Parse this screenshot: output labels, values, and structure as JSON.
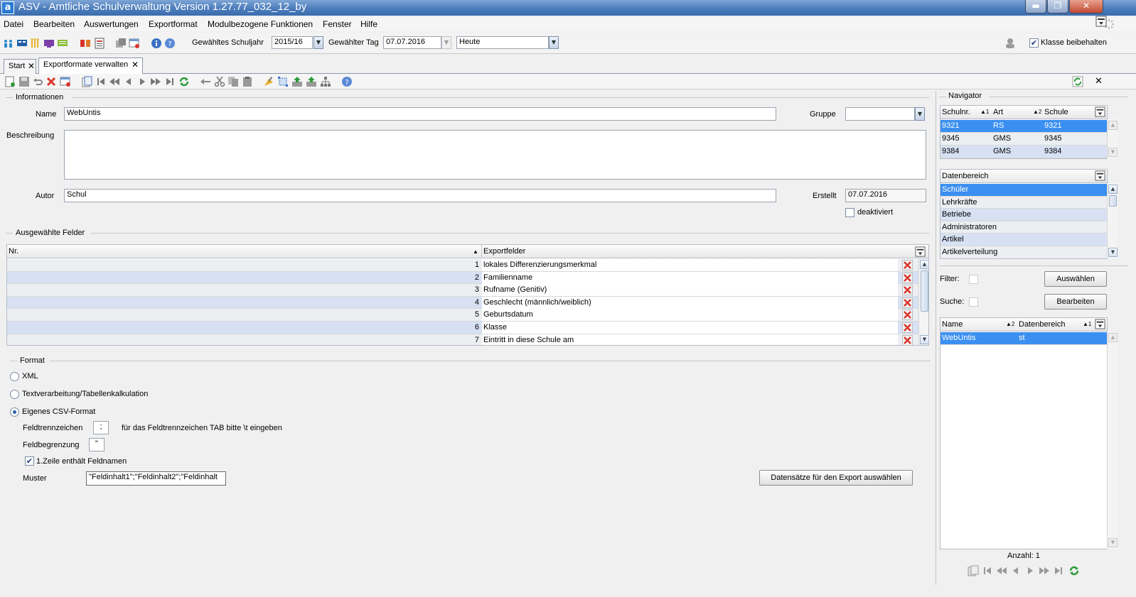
{
  "window": {
    "title": "ASV - Amtliche Schulverwaltung Version 1.27.77_032_12_by",
    "logo_letter": "a",
    "minimize": "▬",
    "restore": "❐",
    "close": "✕"
  },
  "menu": [
    "Datei",
    "Bearbeiten",
    "Auswertungen",
    "Exportformat",
    "Modulbezogene Funktionen",
    "Fenster",
    "Hilfe"
  ],
  "toolbar": {
    "schuljahr_label": "Gewähltes Schuljahr",
    "schuljahr_value": "2015/16",
    "tag_label": "Gewählter Tag",
    "tag_value": "07.07.2016",
    "heute_value": "Heute",
    "klasse_label": "Klasse beibehalten",
    "klasse_checked": true
  },
  "tabs": [
    {
      "label": "Start",
      "close": "✕"
    },
    {
      "label": "Exportformate verwalten",
      "close": "✕"
    }
  ],
  "panel_close": "✕",
  "informationen": {
    "section": "Informationen",
    "name_label": "Name",
    "name_value": "WebUntis",
    "gruppe_label": "Gruppe",
    "gruppe_value": "",
    "beschreibung_label": "Beschreibung",
    "beschreibung_value": "",
    "autor_label": "Autor",
    "autor_value": "Schul",
    "erstellt_label": "Erstellt",
    "erstellt_value": "07.07.2016",
    "deaktiviert_label": "deaktiviert"
  },
  "felder": {
    "section": "Ausgewählte Felder",
    "col_nr": "Nr.",
    "col_export": "Exportfelder",
    "rows": [
      {
        "nr": "1",
        "feld": "lokales Differenzierungsmerkmal"
      },
      {
        "nr": "2",
        "feld": "Familienname"
      },
      {
        "nr": "3",
        "feld": "Rufname (Genitiv)"
      },
      {
        "nr": "4",
        "feld": "Geschlecht (männlich/weiblich)"
      },
      {
        "nr": "5",
        "feld": "Geburtsdatum"
      },
      {
        "nr": "6",
        "feld": "Klasse"
      },
      {
        "nr": "7",
        "feld": "Eintritt in diese Schule am"
      }
    ]
  },
  "format": {
    "section": "Format",
    "xml": "XML",
    "text": "Textverarbeitung/Tabellenkalkulation",
    "csv": "Eigenes CSV-Format",
    "selected": "csv",
    "feldtrenn_label": "Feldtrennzeichen",
    "feldtrenn_value": ";",
    "feldtrenn_hint": "für das Feldtrennzeichen TAB bitte \\t eingeben",
    "feldbegr_label": "Feldbegrenzung",
    "feldbegr_value": "\"",
    "erste_zeile_label": "1.Zeile enthält Feldnamen",
    "erste_zeile_checked": true,
    "muster_label": "Muster",
    "muster_value": "\"Feldinhalt1\";\"Feldinhalt2\";\"Feldinhalt",
    "export_button": "Datensätze für den Export auswählen"
  },
  "navigator": {
    "section": "Navigator",
    "schulen_cols": [
      "Schulnr.",
      "Art",
      "Schule"
    ],
    "schulen_sort": [
      "▲1",
      "▲2",
      ""
    ],
    "schulen": [
      {
        "nr": "9321",
        "art": "RS",
        "schule": "9321"
      },
      {
        "nr": "9345",
        "art": "GMS",
        "schule": "9345"
      },
      {
        "nr": "9384",
        "art": "GMS",
        "schule": "9384"
      }
    ],
    "datenbereich_header": "Datenbereich",
    "datenbereiche": [
      "Schüler",
      "Lehrkräfte",
      "Betriebe",
      "Administratoren",
      "Artikel",
      "Artikelverteilung"
    ],
    "filter_label": "Filter:",
    "suche_label": "Suche:",
    "auswaehlen_button": "Auswählen",
    "bearbeiten_button": "Bearbeiten",
    "result_cols": [
      "Name",
      "Datenbereich"
    ],
    "result_sort": [
      "▲2",
      "▲1"
    ],
    "results": [
      {
        "name": "WebUntis",
        "datenbereich": "st"
      }
    ],
    "anzahl": "Anzahl: 1"
  },
  "colors": {
    "selection": "#3b8ff0",
    "alt_row": "#d7e1f3",
    "delete_red": "#d9342b",
    "title_blue": "#4f7fbd"
  }
}
